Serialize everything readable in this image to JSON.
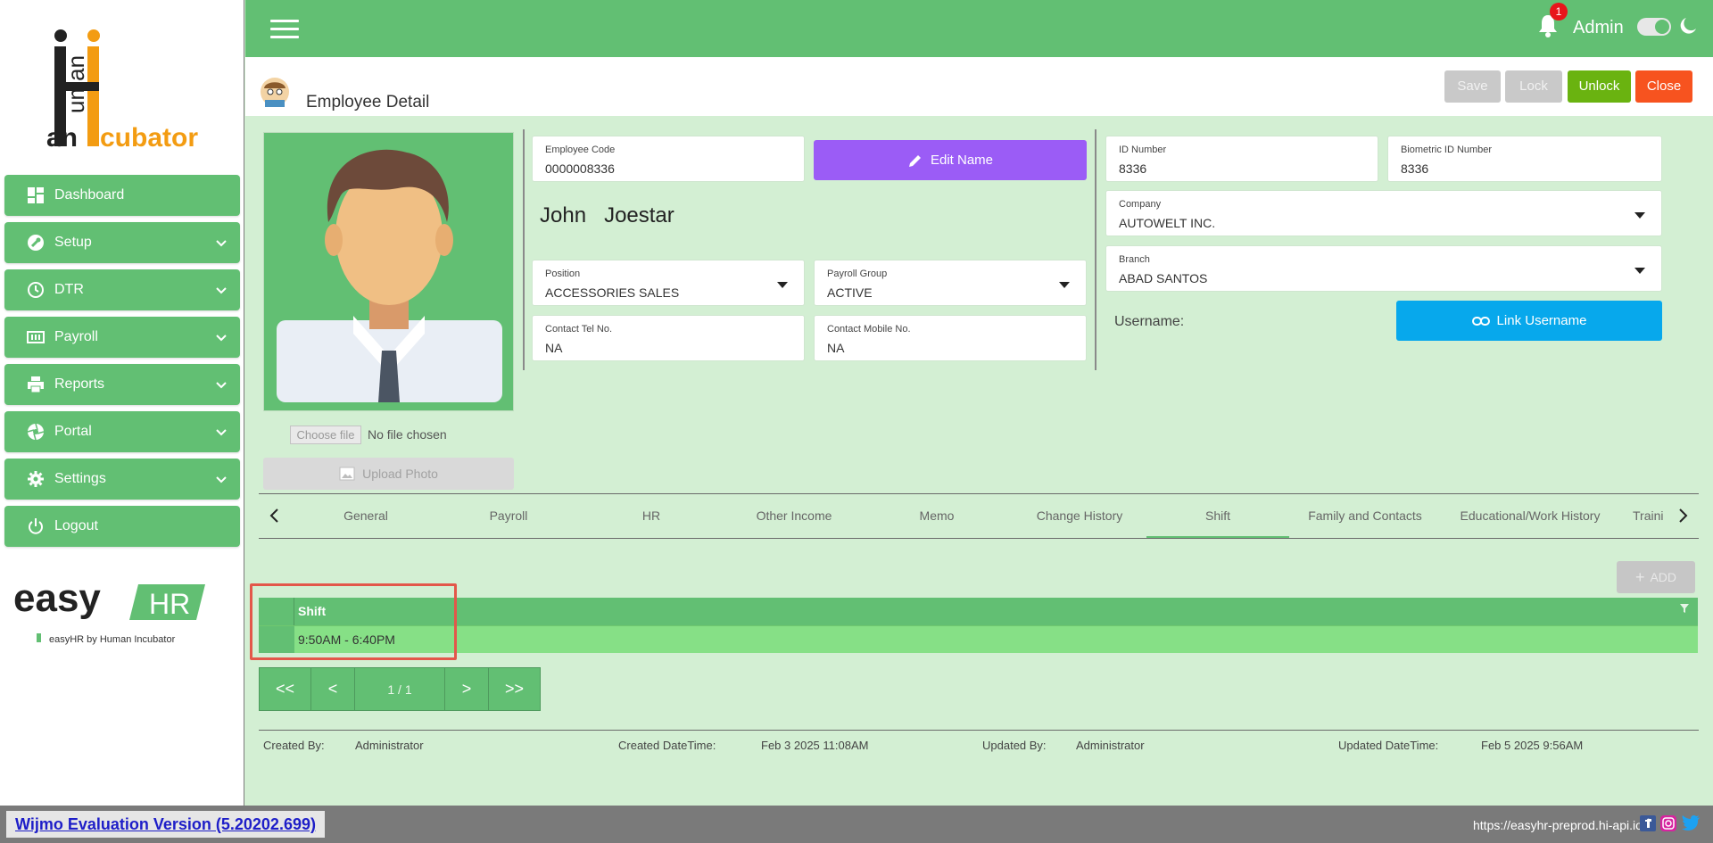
{
  "sidebar": {
    "logo_text_1": "H",
    "logo_text_2": "uman",
    "logo_text_3": "Incubator",
    "items": [
      {
        "label": "Dashboard",
        "icon": "dashboard-icon",
        "has_chevron": false
      },
      {
        "label": "Setup",
        "icon": "wrench-icon",
        "has_chevron": true
      },
      {
        "label": "DTR",
        "icon": "clock-icon",
        "has_chevron": true
      },
      {
        "label": "Payroll",
        "icon": "payroll-icon",
        "has_chevron": true
      },
      {
        "label": "Reports",
        "icon": "printer-icon",
        "has_chevron": true
      },
      {
        "label": "Portal",
        "icon": "aperture-icon",
        "has_chevron": true
      },
      {
        "label": "Settings",
        "icon": "gear-icon",
        "has_chevron": true
      },
      {
        "label": "Logout",
        "icon": "power-icon",
        "has_chevron": false
      }
    ],
    "brand_easy": "easy",
    "brand_hr": "HR",
    "brand_tagline": "easyHR by Human Incubator"
  },
  "topbar": {
    "notification_count": "1",
    "user": "Admin"
  },
  "header": {
    "title": "Employee Detail",
    "buttons": {
      "save": "Save",
      "lock": "Lock",
      "unlock": "Unlock",
      "close": "Close"
    }
  },
  "photo": {
    "choose_file": "Choose file",
    "no_file": "No file chosen",
    "upload": "Upload Photo"
  },
  "employee": {
    "code_label": "Employee Code",
    "code": "0000008336",
    "edit_name": "Edit Name",
    "first_name": "John",
    "last_name": "Joestar",
    "position_label": "Position",
    "position": "ACCESSORIES SALES",
    "payroll_group_label": "Payroll Group",
    "payroll_group": "ACTIVE",
    "tel_label": "Contact Tel No.",
    "tel": "NA",
    "mobile_label": "Contact Mobile No.",
    "mobile": "NA",
    "id_label": "ID Number",
    "id": "8336",
    "bio_label": "Biometric ID Number",
    "bio": "8336",
    "company_label": "Company",
    "company": "AUTOWELT INC.",
    "branch_label": "Branch",
    "branch": "ABAD SANTOS",
    "username_label": "Username:",
    "link_username": "Link Username"
  },
  "tabs": [
    "General",
    "Payroll",
    "HR",
    "Other Income",
    "Memo",
    "Change History",
    "Shift",
    "Family and Contacts",
    "Educational/Work History",
    "Traini"
  ],
  "active_tab": "Shift",
  "grid": {
    "add": "ADD",
    "column": "Shift",
    "rows": [
      "9:50AM - 6:40PM"
    ]
  },
  "pager": {
    "first": "<<",
    "prev": "<",
    "label": "1 / 1",
    "next": ">",
    "last": ">>"
  },
  "audit": {
    "created_by_label": "Created By:",
    "created_by": "Administrator",
    "created_dt_label": "Created DateTime:",
    "created_dt": "Feb 3 2025 11:08AM",
    "updated_by_label": "Updated By:",
    "updated_by": "Administrator",
    "updated_dt_label": "Updated DateTime:",
    "updated_dt": "Feb 5 2025 9:56AM"
  },
  "footer": {
    "wijmo": "Wijmo Evaluation Version (5.20202.699)",
    "url": "https://easyhr-preprod.hi-api.io"
  },
  "colors": {
    "primary": "#62bf73",
    "background": "#d3efd3",
    "edit": "#9b5cf6",
    "link": "#07a8ec",
    "unlock": "#6ab310",
    "close": "#f7531f",
    "disabled": "#c6c6c6"
  }
}
